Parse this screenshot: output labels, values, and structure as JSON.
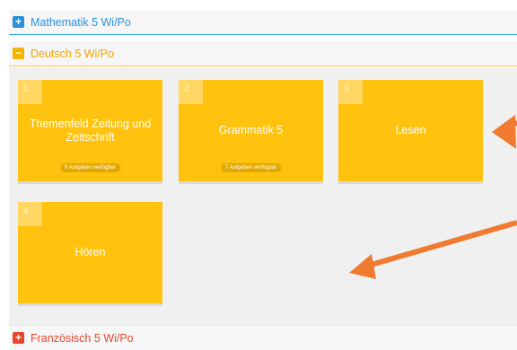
{
  "colors": {
    "math_accent": "#2b90d9",
    "deutsch_accent": "#f5b400",
    "franz_accent": "#e8452c",
    "tile_bg": "#ffc20e",
    "arrow": "#ef7a30"
  },
  "sections": {
    "math": {
      "label": "Mathematik 5 Wi/Po",
      "icon": "+",
      "state": "collapsed"
    },
    "deutsch": {
      "label": "Deutsch 5 Wi/Po",
      "icon": "−",
      "state": "expanded"
    },
    "franz": {
      "label": "Französisch 5 Wi/Po",
      "icon": "+",
      "state": "collapsed"
    }
  },
  "tiles": [
    {
      "num": "1",
      "title": "Themenfeld Zeitung und Zeitschrift",
      "badge": "9 Aufgaben verfügbar"
    },
    {
      "num": "2",
      "title": "Grammatik 5",
      "badge": "7 Aufgaben verfügbar"
    },
    {
      "num": "3",
      "title": "Lesen",
      "badge": ""
    },
    {
      "num": "4",
      "title": "Hören",
      "badge": ""
    }
  ]
}
